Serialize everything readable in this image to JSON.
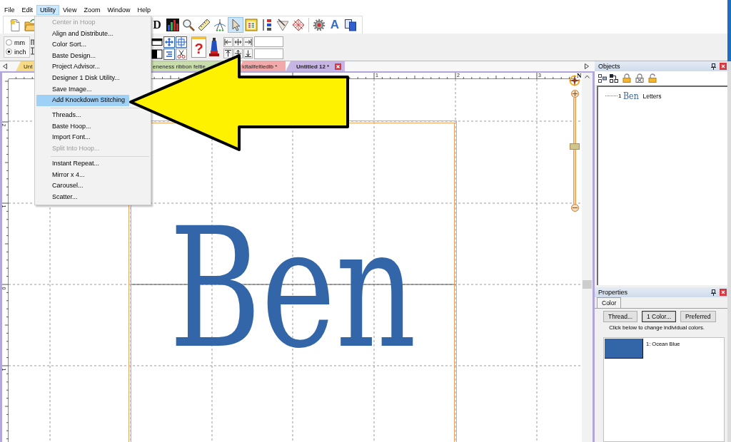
{
  "menu_bar": [
    {
      "label": "File",
      "selected": false
    },
    {
      "label": "Edit",
      "selected": false
    },
    {
      "label": "Utility",
      "selected": true
    },
    {
      "label": "View",
      "selected": false
    },
    {
      "label": "Zoom",
      "selected": false
    },
    {
      "label": "Window",
      "selected": false
    },
    {
      "label": "Help",
      "selected": false
    }
  ],
  "utility_menu": [
    {
      "kind": "item",
      "label": "Center in Hoop",
      "disabled": true,
      "selected": false
    },
    {
      "kind": "item",
      "label": "Align and Distribute...",
      "disabled": false,
      "selected": false
    },
    {
      "kind": "item",
      "label": "Color Sort...",
      "disabled": false,
      "selected": false
    },
    {
      "kind": "item",
      "label": "Baste Design...",
      "disabled": false,
      "selected": false
    },
    {
      "kind": "item",
      "label": "Project Advisor...",
      "disabled": false,
      "selected": false
    },
    {
      "kind": "item",
      "label": "Designer 1 Disk Utility...",
      "disabled": false,
      "selected": false
    },
    {
      "kind": "item",
      "label": "Save Image...",
      "disabled": false,
      "selected": false
    },
    {
      "kind": "item",
      "label": "Add Knockdown Stitching",
      "disabled": false,
      "selected": true
    },
    {
      "kind": "separator"
    },
    {
      "kind": "item",
      "label": "Threads...",
      "disabled": false,
      "selected": false
    },
    {
      "kind": "item",
      "label": "Baste Hoop...",
      "disabled": false,
      "selected": false
    },
    {
      "kind": "item",
      "label": "Import Font...",
      "disabled": false,
      "selected": false
    },
    {
      "kind": "item",
      "label": "Split Into Hoop...",
      "disabled": true,
      "selected": false
    },
    {
      "kind": "separator"
    },
    {
      "kind": "item",
      "label": "Instant Repeat...",
      "disabled": false,
      "selected": false
    },
    {
      "kind": "item",
      "label": "Mirror x 4...",
      "disabled": false,
      "selected": false
    },
    {
      "kind": "item",
      "label": "Carousel...",
      "disabled": false,
      "selected": false
    },
    {
      "kind": "item",
      "label": "Scatter...",
      "disabled": false,
      "selected": false
    }
  ],
  "main_toolbar": {
    "left_tools": [
      {
        "kind": "new",
        "selected": false
      },
      {
        "kind": "open",
        "selected": false
      }
    ],
    "right_tools": [
      {
        "kind": "letter",
        "label": "D",
        "selected": false
      },
      {
        "kind": "chart",
        "selected": false
      },
      {
        "kind": "magnifier",
        "selected": false
      },
      {
        "kind": "ruler",
        "selected": false
      },
      {
        "kind": "arc",
        "selected": false
      },
      {
        "kind": "pointer",
        "selected": true
      },
      {
        "kind": "window",
        "selected": false
      },
      {
        "kind": "needle",
        "selected": false
      },
      {
        "kind": "triangle",
        "selected": false
      },
      {
        "kind": "mesh",
        "selected": false
      },
      {
        "kind": "separator"
      },
      {
        "kind": "gear",
        "selected": false
      },
      {
        "kind": "fontletter",
        "label": "A",
        "selected": false
      },
      {
        "kind": "copy",
        "selected": false
      }
    ]
  },
  "units": [
    {
      "label": "mm",
      "selected": false
    },
    {
      "label": "inch",
      "selected": true
    }
  ],
  "edit_toolbar": {
    "grid_tools": [
      {
        "kind": "frame"
      },
      {
        "kind": "expand"
      },
      {
        "kind": "target"
      },
      {
        "kind": "half"
      },
      {
        "kind": "lines"
      },
      {
        "kind": "scissors"
      }
    ],
    "tools": [
      {
        "kind": "help",
        "label": "?"
      },
      {
        "kind": "pin"
      }
    ],
    "align_buttons": [
      {
        "kind": "left"
      },
      {
        "kind": "center"
      },
      {
        "kind": "right"
      },
      {
        "kind": "top"
      },
      {
        "kind": "middle"
      },
      {
        "kind": "bottom"
      }
    ]
  },
  "design_tabs": [
    {
      "label": "Unt",
      "color": "#f7da86",
      "selected": false
    },
    {
      "label": "eneness ribbon feltie",
      "color": "#c9dcab",
      "selected": false
    },
    {
      "label": "idtailfeltiedlb *",
      "color": "#f2a9a9",
      "selected": false
    },
    {
      "label": "Untitled 12 *",
      "color": "#c7b6e4",
      "selected": true
    }
  ],
  "canvas": {
    "top_ruler_labels": [
      "1",
      "2",
      "3"
    ],
    "left_ruler_labels": [
      "2",
      "1",
      "0",
      "1"
    ],
    "design_text": "Ben",
    "zoom_slider": {
      "north_label": "N",
      "level": 0.54
    }
  },
  "objects": {
    "title": "Objects",
    "tree": [
      {
        "number": "1",
        "thumbnail": "Ben",
        "label": "Letters",
        "selected": false
      }
    ]
  },
  "properties": {
    "title": "Properties",
    "tabs": [
      {
        "label": "Color",
        "selected": true
      }
    ],
    "buttons": [
      {
        "label": "Thread...",
        "default": false
      },
      {
        "label": "1 Color...",
        "default": true
      },
      {
        "label": "Preferred",
        "default": false
      }
    ],
    "hint": "Click below to change individual colors.",
    "colors": [
      {
        "label": "1: Ocean Blue",
        "color": "#3366a8",
        "selected": false
      }
    ]
  }
}
